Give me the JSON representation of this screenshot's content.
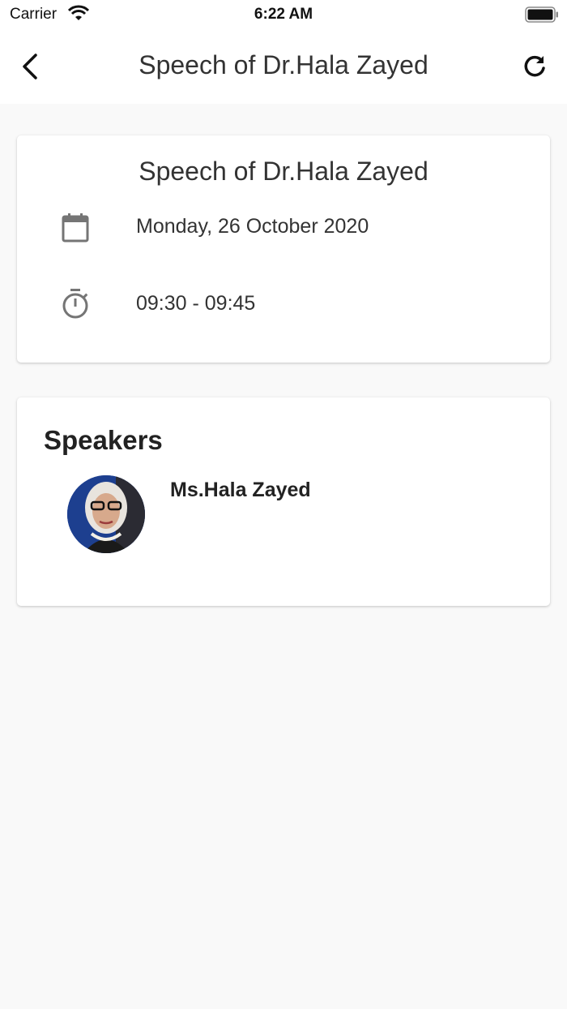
{
  "status_bar": {
    "carrier": "Carrier",
    "time": "6:22 AM",
    "wifi_icon": "wifi-icon",
    "battery_icon": "battery-icon"
  },
  "app_bar": {
    "title": "Speech of Dr.Hala  Zayed",
    "back_icon": "chevron-left-icon",
    "refresh_icon": "refresh-icon"
  },
  "event": {
    "title": "Speech of Dr.Hala  Zayed",
    "date_icon": "calendar-icon",
    "date": "Monday, 26 October 2020",
    "time_icon": "stopwatch-icon",
    "time": "09:30 - 09:45"
  },
  "speakers": {
    "heading": "Speakers",
    "items": [
      {
        "name": "Ms.Hala Zayed"
      }
    ]
  },
  "colors": {
    "background": "#f9f9f9",
    "surface": "#ffffff",
    "icon_gray": "#757575",
    "text": "#333333"
  }
}
